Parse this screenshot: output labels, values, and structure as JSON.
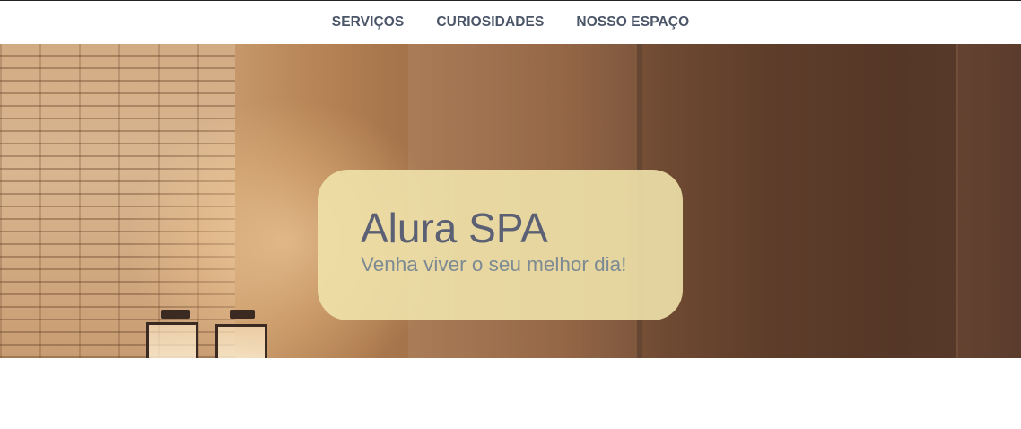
{
  "nav": {
    "items": [
      {
        "label": "SERVIÇOS"
      },
      {
        "label": "CURIOSIDADES"
      },
      {
        "label": "NOSSO ESPAÇO"
      }
    ]
  },
  "hero": {
    "title": "Alura SPA",
    "subtitle": "Venha viver o seu melhor dia!"
  },
  "colors": {
    "nav_text": "#4b5568",
    "card_background": "#f0e2aa",
    "title_text": "#5b6075",
    "subtitle_text": "#7d8a93"
  }
}
